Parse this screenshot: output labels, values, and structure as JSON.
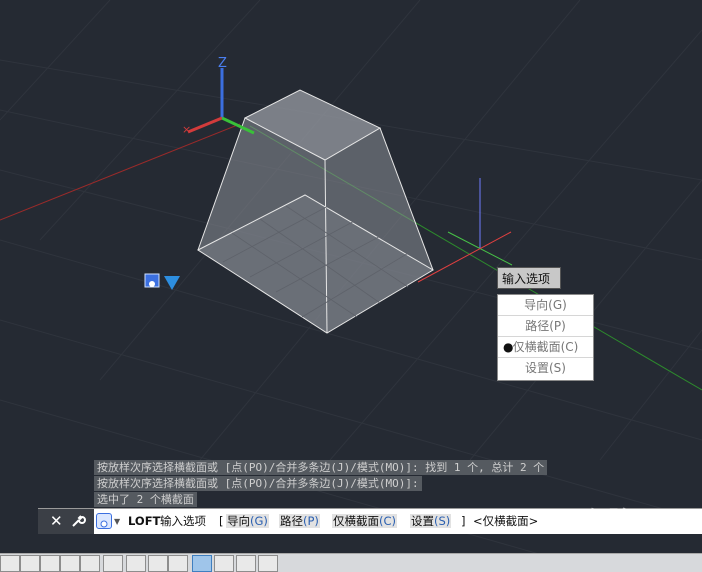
{
  "canvas": {
    "ucs_axis_z_label": "Z",
    "background_color": "#252a33"
  },
  "dynamic_input": {
    "prompt": "输入选项"
  },
  "option_menu": {
    "items": [
      {
        "label": "导向(G)",
        "selected": false
      },
      {
        "label": "路径(P)",
        "selected": false
      },
      {
        "label": "仅横截面(C)",
        "selected": true
      },
      {
        "label": "设置(S)",
        "selected": false
      }
    ],
    "bullet": "●"
  },
  "command_history": [
    "按放样次序选择横截面或 [点(PO)/合并多条边(J)/模式(MO)]: 找到 1 个, 总计 2 个",
    "按放样次序选择横截面或 [点(PO)/合并多条边(J)/模式(MO)]:",
    "选中了 2 个横截面"
  ],
  "command_line": {
    "command": "LOFT",
    "prompt": "输入选项",
    "open_bracket": "[",
    "options": [
      {
        "text": "导向",
        "key": "(G)"
      },
      {
        "text": "路径",
        "key": "(P)"
      },
      {
        "text": "仅横截面",
        "key": "(C)"
      },
      {
        "text": "设置",
        "key": "(S)"
      }
    ],
    "close_bracket": "]",
    "default": "<仅横截面>"
  },
  "watermark": {
    "text": "Bai 经验"
  }
}
